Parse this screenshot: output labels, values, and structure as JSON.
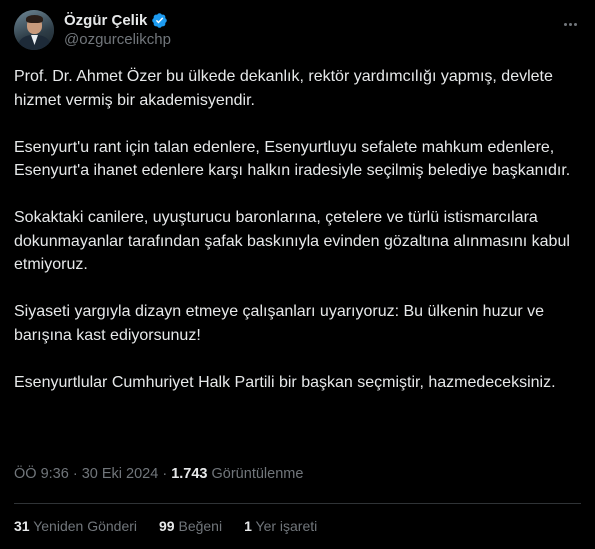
{
  "author": {
    "name": "Özgür Çelik",
    "handle": "@ozgurcelikchp",
    "verified_color": "#1d9bf0"
  },
  "tweet": {
    "paragraphs": [
      "Prof. Dr. Ahmet Özer bu ülkede dekanlık, rektör yardımcılığı yapmış, devlete hizmet vermiş bir akademisyendir.",
      "Esenyurt'u rant için talan edenlere, Esenyurtluyu sefalete mahkum edenlere, Esenyurt'a ihanet edenlere karşı halkın iradesiyle seçilmiş belediye başkanıdır.",
      "Sokaktaki canilere, uyuşturucu baronlarına, çetelere ve türlü istismarcılara dokunmayanlar tarafından şafak baskınıyla evinden gözaltına alınmasını kabul etmiyoruz.",
      "Siyaseti yargıyla dizayn etmeye çalışanları uyarıyoruz: Bu ülkenin huzur ve barışına kast ediyorsunuz!",
      "Esenyurtlular Cumhuriyet Halk Partili bir başkan seçmiştir, hazmedeceksiniz."
    ]
  },
  "meta": {
    "time": "ÖÖ 9:36",
    "separator": " · ",
    "date": "30 Eki 2024",
    "views_count": "1.743",
    "views_label": " Görüntülenme"
  },
  "stats": {
    "retweets_count": "31",
    "retweets_label": " Yeniden Gönderi",
    "likes_count": "99",
    "likes_label": " Beğeni",
    "bookmarks_count": "1",
    "bookmarks_label": " Yer işareti"
  }
}
